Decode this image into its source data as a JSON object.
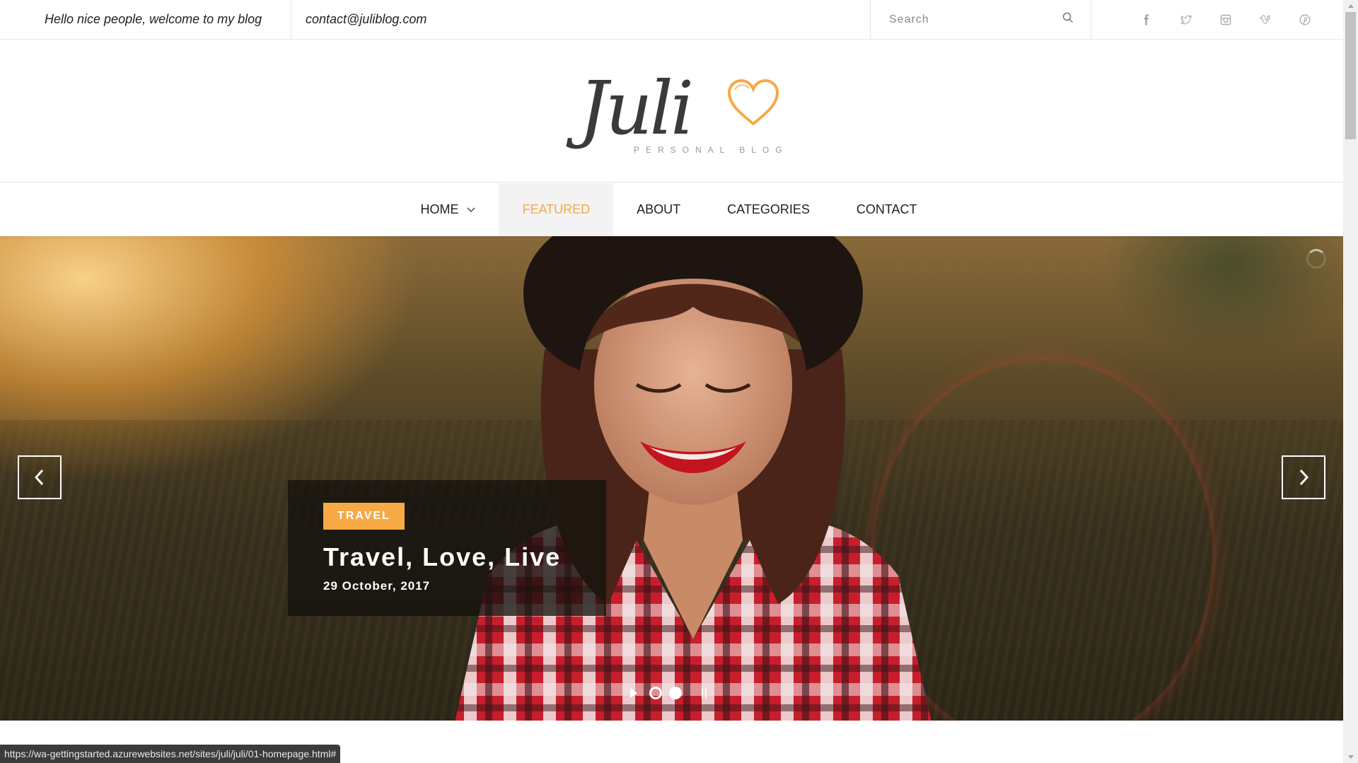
{
  "topbar": {
    "welcome": "Hello nice people, welcome to my blog",
    "email": "contact@juliblog.com",
    "search_placeholder": "Search",
    "social_icons": [
      "facebook-icon",
      "twitter-icon",
      "instagram-icon",
      "vimeo-icon",
      "pinterest-icon"
    ]
  },
  "logo": {
    "word": "Juli",
    "tagline": "PERSONAL BLOG"
  },
  "nav": {
    "items": [
      {
        "label": "HOME",
        "has_dropdown": true,
        "active": false
      },
      {
        "label": "FEATURED",
        "active": true
      },
      {
        "label": "ABOUT",
        "active": false
      },
      {
        "label": "CATEGORIES",
        "active": false
      },
      {
        "label": "CONTACT",
        "active": false
      }
    ]
  },
  "slide": {
    "category": "TRAVEL",
    "title": "Travel, Love, Live",
    "date": "29 October, 2017"
  },
  "status_url": "https://wa-gettingstarted.azurewebsites.net/sites/juli/juli/01-homepage.html#",
  "colors": {
    "accent": "#f7a944",
    "text": "#222222",
    "border": "#e6e6e6"
  }
}
